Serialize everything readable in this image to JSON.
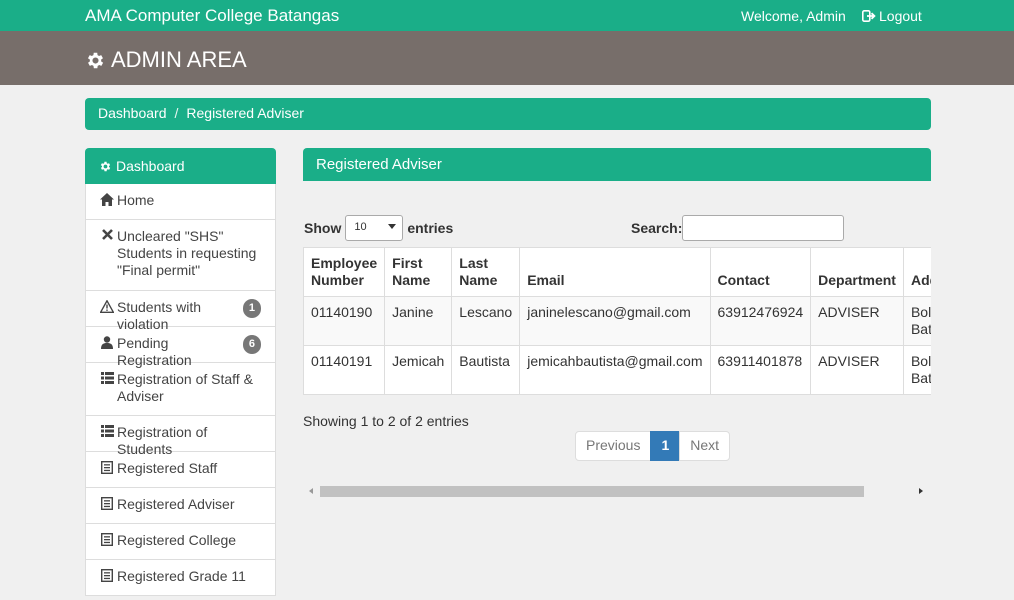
{
  "topbar": {
    "brand": "AMA Computer College Batangas",
    "welcome": "Welcome, Admin",
    "logout": "Logout"
  },
  "admin_bar": {
    "title": "ADMIN AREA"
  },
  "breadcrumb": {
    "items": [
      "Dashboard",
      "/",
      "Registered Adviser"
    ]
  },
  "sidebar": {
    "heading": "Dashboard",
    "items": [
      {
        "label": "Home",
        "icon": "home-icon"
      },
      {
        "label": "Uncleared \"SHS\" Students in requesting \"Final permit\"",
        "icon": "times-icon"
      },
      {
        "label": "Students with violation",
        "icon": "warning-icon",
        "badge": "1"
      },
      {
        "label": "Pending Registration",
        "icon": "user-icon",
        "badge": "6"
      },
      {
        "label": "Registration of Staff & Adviser",
        "icon": "list-icon"
      },
      {
        "label": "Registration of Students",
        "icon": "list-icon"
      },
      {
        "label": "Registered Staff",
        "icon": "list-alt-icon"
      },
      {
        "label": "Registered Adviser",
        "icon": "list-alt-icon"
      },
      {
        "label": "Registered College",
        "icon": "list-alt-icon"
      },
      {
        "label": "Registered Grade 11",
        "icon": "list-alt-icon"
      }
    ]
  },
  "panel": {
    "title": "Registered Adviser"
  },
  "table_controls": {
    "show_label": "Show",
    "length_value": "10",
    "entries_label": "entries",
    "search_label": "Search:"
  },
  "table": {
    "headers": [
      "Employee Number",
      "First Name",
      "Last Name",
      "Email",
      "Contact",
      "Department",
      "Address"
    ],
    "rows": [
      [
        "01140190",
        "Janine",
        "Lescano",
        "janinelescano@gmail.com",
        "63912476924",
        "ADVISER",
        "Bolbok Batangas"
      ],
      [
        "01140191",
        "Jemicah",
        "Bautista",
        "jemicahbautista@gmail.com",
        "63911401878",
        "ADVISER",
        "Bolbok Batangas"
      ]
    ]
  },
  "info": "Showing 1 to 2 of 2 entries",
  "pagination": {
    "previous": "Previous",
    "current": "1",
    "next": "Next"
  },
  "colors": {
    "primary": "#1aae88",
    "admin_bar": "#776e6a",
    "active_page": "#337ab7"
  }
}
